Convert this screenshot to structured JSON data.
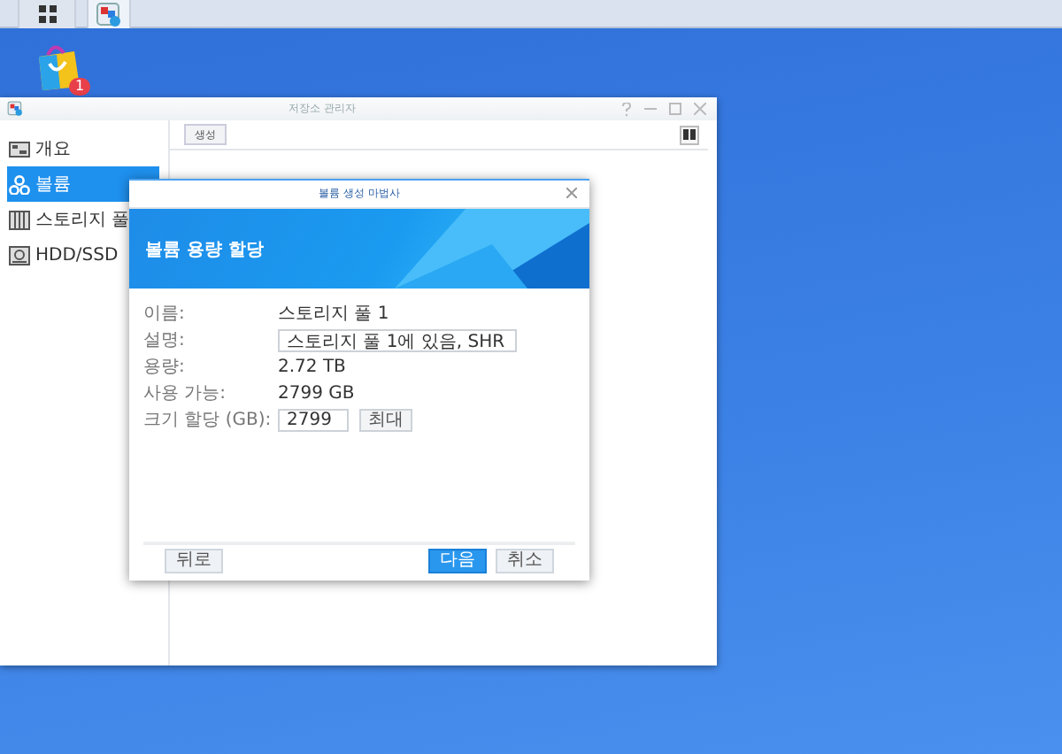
{
  "taskbar": {
    "buttons": [
      {
        "kind": "main_menu",
        "selected": false
      },
      {
        "kind": "storage_manager",
        "selected": true
      }
    ]
  },
  "desktop_icons": [
    {
      "kind": "package_center",
      "badge": "1"
    }
  ],
  "window": {
    "title": "저장소 관리자",
    "sidebar": {
      "items": [
        {
          "label": "개요",
          "kind": "overview",
          "selected": false
        },
        {
          "label": "볼륨",
          "kind": "volume",
          "selected": true
        },
        {
          "label": "스토리지 풀",
          "kind": "pool",
          "selected": false
        },
        {
          "label": "HDD/SSD",
          "kind": "disk",
          "selected": false
        }
      ]
    },
    "toolbar": {
      "buttons": [
        "생성"
      ]
    }
  },
  "dialog": {
    "title": "볼륨 생성 마법사",
    "heading": "볼륨 용량 할당",
    "fields": [
      {
        "kind": "text",
        "label": "이름:",
        "value": "스토리지 풀 1"
      },
      {
        "kind": "input",
        "label": "설명:",
        "value": "스토리지 풀 1에 있음, SHR"
      },
      {
        "kind": "text",
        "label": "용량:",
        "value": "2.72 TB"
      },
      {
        "kind": "text",
        "label": "사용 가능:",
        "value": "2799 GB"
      },
      {
        "kind": "input",
        "label": "크기 할당 (GB):",
        "value": "2799",
        "button": "최대"
      }
    ],
    "buttons": [
      {
        "kind": "back",
        "label": "뒤로"
      },
      {
        "kind": "primary",
        "label": "다음"
      },
      {
        "kind": "secondary",
        "label": "취소"
      }
    ]
  }
}
